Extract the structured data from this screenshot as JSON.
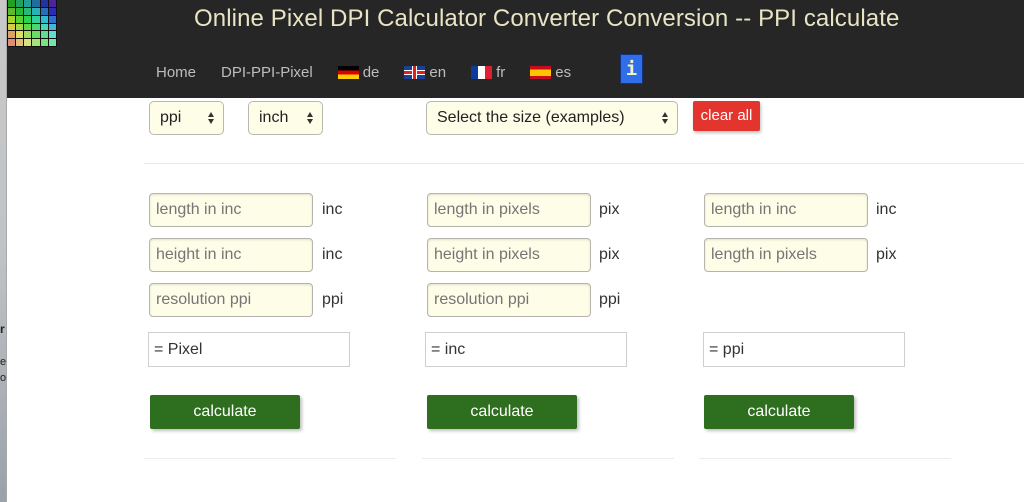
{
  "background_window": {
    "fragments": [
      "r",
      "e",
      "o"
    ]
  },
  "header": {
    "title": "Online Pixel DPI Calculator Converter Conversion -- PPI calculate",
    "logo_icon": "color-grid-logo-icon",
    "nav": [
      {
        "label": "Home",
        "icon": null
      },
      {
        "label": "DPI-PPI-Pixel",
        "icon": null
      },
      {
        "label": "de",
        "icon": "flag-germany-icon"
      },
      {
        "label": "en",
        "icon": "flag-uk-icon"
      },
      {
        "label": "fr",
        "icon": "flag-france-icon"
      },
      {
        "label": "es",
        "icon": "flag-spain-icon"
      }
    ],
    "info_button": {
      "label": "i",
      "icon": "info-icon"
    }
  },
  "toolbar": {
    "resolution_unit_select": "ppi",
    "length_unit_select": "inch",
    "size_examples_select": "Select the size (examples)",
    "clear_all_label": "clear all"
  },
  "columns": [
    {
      "fields": [
        {
          "placeholder": "length in inc",
          "value": "",
          "unit": "inc"
        },
        {
          "placeholder": "height in inc",
          "value": "",
          "unit": "inc"
        },
        {
          "placeholder": "resolution ppi",
          "value": "",
          "unit": "ppi"
        }
      ],
      "result": "= Pixel",
      "button": "calculate"
    },
    {
      "fields": [
        {
          "placeholder": "length in pixels",
          "value": "",
          "unit": "pix"
        },
        {
          "placeholder": "height in pixels",
          "value": "",
          "unit": "pix"
        },
        {
          "placeholder": "resolution ppi",
          "value": "",
          "unit": "ppi"
        }
      ],
      "result": "= inc",
      "button": "calculate"
    },
    {
      "fields": [
        {
          "placeholder": "length in inc",
          "value": "",
          "unit": "inc"
        },
        {
          "placeholder": "length in pixels",
          "value": "",
          "unit": "pix"
        }
      ],
      "result": "= ppi",
      "button": "calculate"
    }
  ],
  "colors": {
    "header_bg": "#262626",
    "title": "#e8e4c4",
    "nav_text": "#bdbdbd",
    "info_button": "#2f6ee8",
    "clear_button": "#e3342d",
    "calculate_button": "#2d6e1f",
    "input_bg": "#fefde8"
  }
}
